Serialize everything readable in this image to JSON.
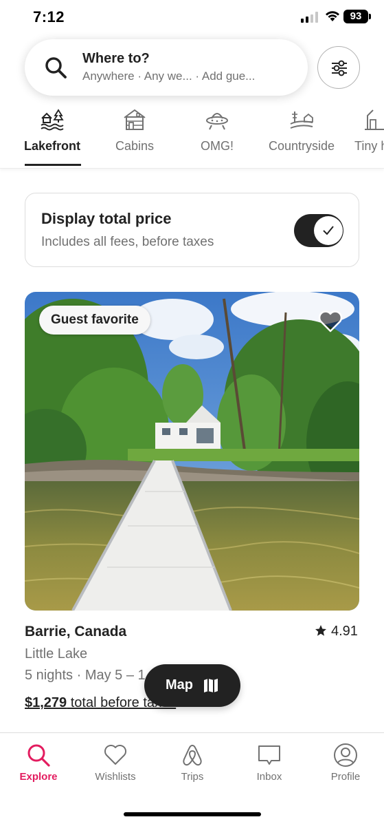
{
  "status_bar": {
    "time": "7:12",
    "battery": "93"
  },
  "search": {
    "title": "Where to?",
    "subtitle": "Anywhere · Any we... · Add gue..."
  },
  "categories": [
    {
      "label": "Lakefront",
      "icon": "lakefront-icon",
      "active": true
    },
    {
      "label": "Cabins",
      "icon": "cabin-icon",
      "active": false
    },
    {
      "label": "OMG!",
      "icon": "ufo-icon",
      "active": false
    },
    {
      "label": "Countryside",
      "icon": "countryside-icon",
      "active": false
    },
    {
      "label": "Tiny h",
      "icon": "tiny-home-icon",
      "active": false
    }
  ],
  "price_toggle": {
    "title": "Display total price",
    "subtitle": "Includes all fees, before taxes",
    "enabled": true
  },
  "listing": {
    "badge": "Guest favorite",
    "location": "Barrie, Canada",
    "rating": "4.91",
    "place": "Little Lake",
    "dates": "5 nights · May 5 – 1",
    "price": "$1,279",
    "price_suffix": " total before taxes"
  },
  "map_button": {
    "label": "Map"
  },
  "bottom_nav": [
    {
      "label": "Explore",
      "icon": "search-icon",
      "active": true
    },
    {
      "label": "Wishlists",
      "icon": "heart-icon",
      "active": false
    },
    {
      "label": "Trips",
      "icon": "airbnb-logo-icon",
      "active": false
    },
    {
      "label": "Inbox",
      "icon": "message-icon",
      "active": false
    },
    {
      "label": "Profile",
      "icon": "profile-icon",
      "active": false
    }
  ],
  "colors": {
    "accent": "#e31c5f",
    "text": "#222222",
    "muted": "#717171"
  }
}
